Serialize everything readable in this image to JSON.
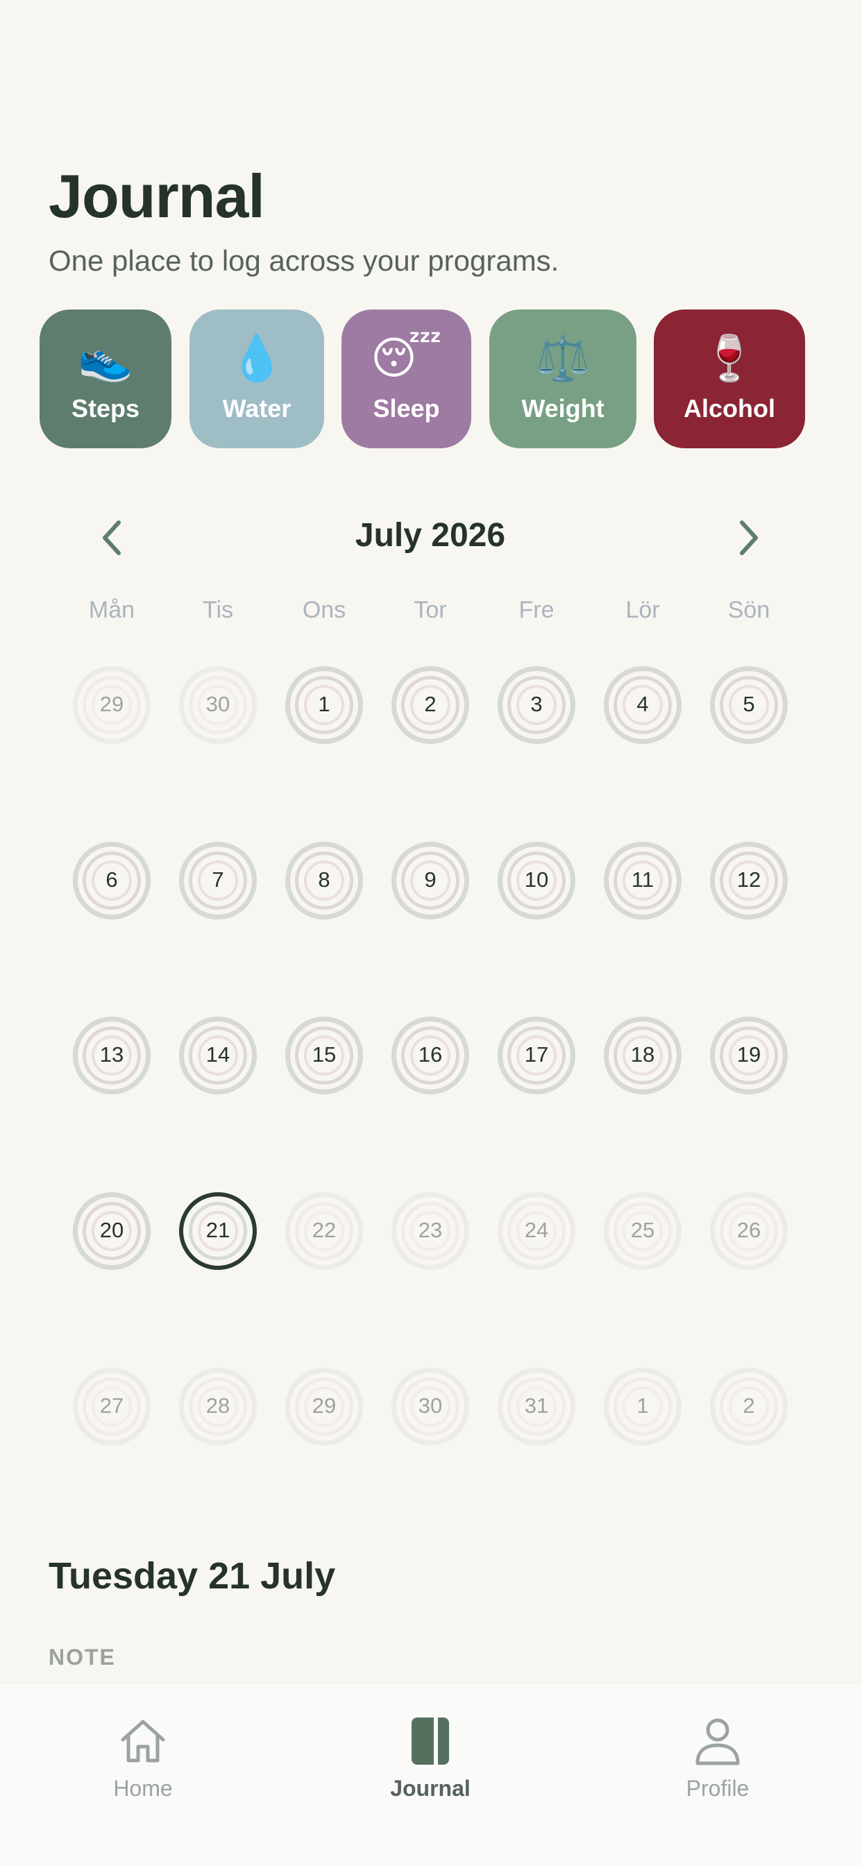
{
  "header": {
    "title": "Journal",
    "subtitle": "One place to log across your programs."
  },
  "programs": [
    {
      "label": "Steps",
      "emoji": "👟",
      "icon": "sneaker-icon",
      "color": "#5e7d6e"
    },
    {
      "label": "Water",
      "emoji": "💧",
      "icon": "water-drop-icon",
      "color": "#9ebdc5"
    },
    {
      "label": "Sleep",
      "emoji": "😴",
      "icon": "sleeping-face-icon",
      "color": "#9e7ba2"
    },
    {
      "label": "Weight",
      "emoji": "⚖️",
      "icon": "scale-icon",
      "color": "#79a084"
    },
    {
      "label": "Alcohol",
      "emoji": "🍷",
      "icon": "wine-glass-icon",
      "color": "#8b2433"
    }
  ],
  "calendar": {
    "month_label": "July 2026",
    "weekdays": [
      "Mån",
      "Tis",
      "Ons",
      "Tor",
      "Fre",
      "Lör",
      "Sön"
    ],
    "selected_day": "21",
    "weeks": [
      [
        "29",
        "30",
        "1",
        "2",
        "3",
        "4",
        "5"
      ],
      [
        "6",
        "7",
        "8",
        "9",
        "10",
        "11",
        "12"
      ],
      [
        "13",
        "14",
        "15",
        "16",
        "17",
        "18",
        "19"
      ],
      [
        "20",
        "21",
        "22",
        "23",
        "24",
        "25",
        "26"
      ],
      [
        "27",
        "28",
        "29",
        "30",
        "31",
        "1",
        "2"
      ]
    ],
    "muted": [
      [
        true,
        true,
        false,
        false,
        false,
        false,
        false
      ],
      [
        false,
        false,
        false,
        false,
        false,
        false,
        false
      ],
      [
        false,
        false,
        false,
        false,
        false,
        false,
        false
      ],
      [
        false,
        false,
        true,
        true,
        true,
        true,
        true
      ],
      [
        true,
        true,
        true,
        true,
        true,
        true,
        true
      ]
    ]
  },
  "detail": {
    "date_heading": "Tuesday 21 July",
    "note_label": "NOTE"
  },
  "tabbar": {
    "items": [
      {
        "label": "Home",
        "icon": "home-icon",
        "active": false
      },
      {
        "label": "Journal",
        "icon": "journal-icon",
        "active": true
      },
      {
        "label": "Profile",
        "icon": "profile-icon",
        "active": false
      }
    ]
  }
}
